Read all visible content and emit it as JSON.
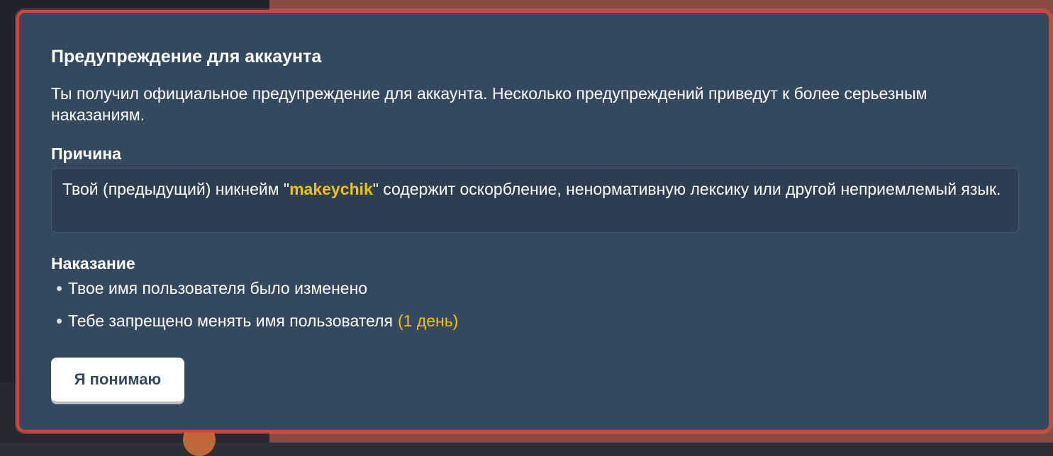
{
  "dialog": {
    "title": "Предупреждение для аккаунта",
    "description": "Ты получил официальное предупреждение для аккаунта. Несколько предупреждений приведут к более серьезным наказаниям.",
    "reason": {
      "heading": "Причина",
      "text_before": "Твой (предыдущий) никнейм \"",
      "username": "makeychik",
      "text_after": "\" содержит оскорбление, ненормативную лексику или другой неприемлемый язык."
    },
    "punishment": {
      "heading": "Наказание",
      "items": [
        {
          "text": "Твое имя пользователя было изменено",
          "duration": ""
        },
        {
          "text": "Тебе запрещено менять имя пользователя",
          "duration": "(1 день)"
        }
      ]
    },
    "acknowledge_label": "Я понимаю"
  },
  "colors": {
    "modal_background": "#35495e",
    "modal_border": "#d2453b",
    "accent_yellow": "#f2c100",
    "reason_box_background": "#2c3e50",
    "button_background": "#ffffff",
    "button_text": "#35495e"
  }
}
